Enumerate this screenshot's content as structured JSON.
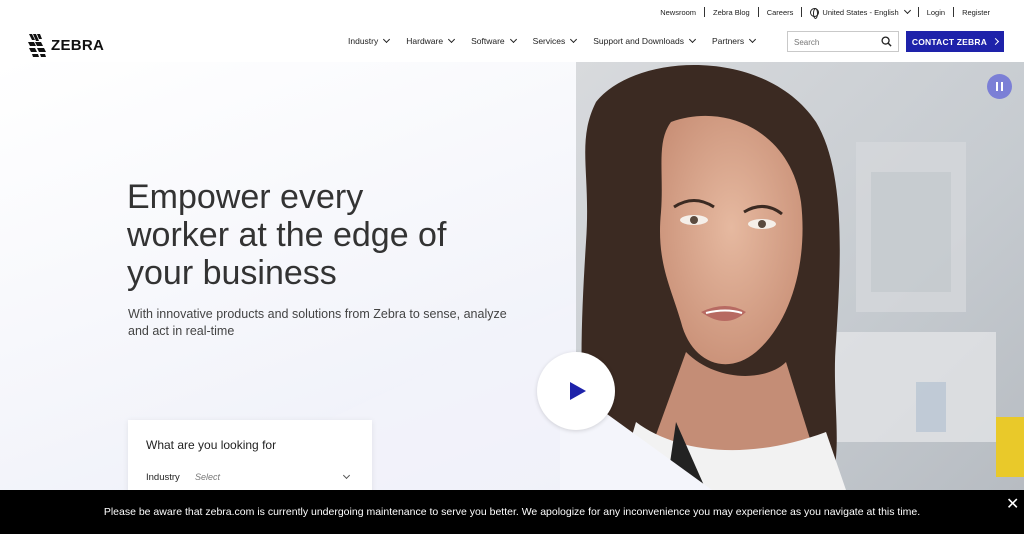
{
  "utility_nav": {
    "newsroom": "Newsroom",
    "blog": "Zebra Blog",
    "careers": "Careers",
    "language": "United States - English",
    "login": "Login",
    "register": "Register"
  },
  "header": {
    "logo_text": "ZEBRA",
    "nav": [
      "Industry",
      "Hardware",
      "Software",
      "Services",
      "Support and Downloads",
      "Partners"
    ],
    "search_placeholder": "Search",
    "contact_label": "CONTACT ZEBRA"
  },
  "hero": {
    "headline_line1": "Empower every",
    "headline_line2": "worker at the edge of",
    "headline_line3": "your business",
    "subhead": "With innovative products and solutions from Zebra to sense, analyze and act in real-time"
  },
  "finder": {
    "title": "What are you looking for",
    "industry_label": "Industry",
    "industry_value": "Select"
  },
  "notice": {
    "text": "Please be aware that zebra.com is currently undergoing maintenance to serve you better. We apologize for any inconvenience you may experience as you navigate at this time.",
    "close": "✕"
  },
  "colors": {
    "brand_blue": "#1e22aa",
    "pause_purple": "#7b7fd6",
    "notice_bg": "#000000"
  },
  "icons": [
    "zebra-logo-icon",
    "globe-icon",
    "chevron-down-icon",
    "search-icon",
    "chevron-right-icon",
    "pause-icon",
    "play-icon",
    "close-icon"
  ]
}
